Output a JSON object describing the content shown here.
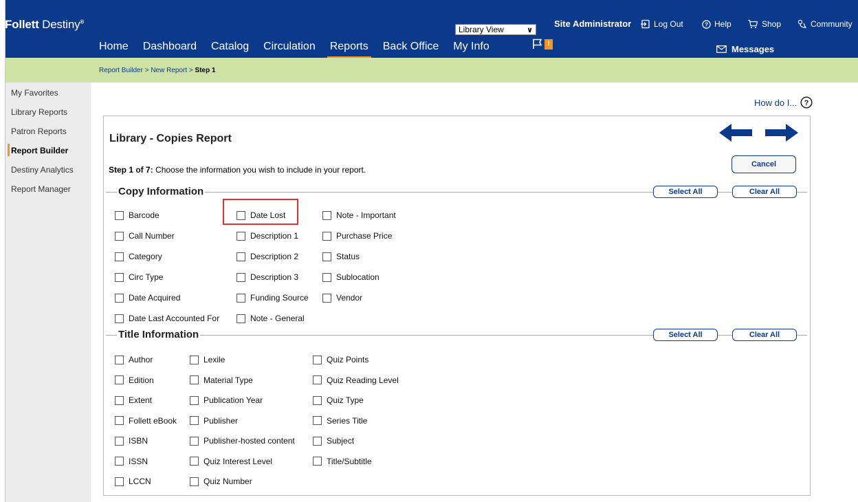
{
  "header": {
    "logo_bold": "Follett",
    "logo_light": " Destiny",
    "logo_reg": "®",
    "view_select": "Library View",
    "user": "Site Administrator",
    "links": {
      "logout": "Log Out",
      "help": "Help",
      "shop": "Shop",
      "community": "Community"
    },
    "nav": [
      "Home",
      "Dashboard",
      "Catalog",
      "Circulation",
      "Reports",
      "Back Office",
      "My Info"
    ],
    "nav_active": "Reports",
    "flag_badge": "!",
    "messages": "Messages"
  },
  "breadcrumb": {
    "items": [
      "Report Builder",
      "New Report"
    ],
    "separator": " > ",
    "current": "Step 1"
  },
  "sidebar": {
    "items": [
      "My Favorites",
      "Library Reports",
      "Patron Reports",
      "Report Builder",
      "Destiny Analytics",
      "Report Manager"
    ],
    "active": "Report Builder"
  },
  "main": {
    "how_do": "How do I...",
    "how_do_icon": "?",
    "title": "Library - Copies Report",
    "step_bold": "Step 1 of 7:",
    "step_text": " Choose the information you wish to include in your report.",
    "cancel": "Cancel",
    "select_all": "Select All",
    "clear_all": "Clear All",
    "copy_section": {
      "title": "Copy Information",
      "columns": [
        [
          "Barcode",
          "Call Number",
          "Category",
          "Circ Type",
          "Date Acquired",
          "Date Last Accounted For"
        ],
        [
          "Date Lost",
          "Description 1",
          "Description 2",
          "Description 3",
          "Funding Source",
          "Note - General"
        ],
        [
          "Note - Important",
          "Purchase Price",
          "Status",
          "Sublocation",
          "Vendor"
        ]
      ]
    },
    "title_section": {
      "title": "Title Information",
      "columns": [
        [
          "Author",
          "Edition",
          "Extent",
          "Follett eBook",
          "ISBN",
          "ISSN",
          "LCCN"
        ],
        [
          "Lexile",
          "Material Type",
          "Publication Year",
          "Publisher",
          "Publisher-hosted content",
          "Quiz Interest Level",
          "Quiz Number"
        ],
        [
          "Quiz Points",
          "Quiz Reading Level",
          "Quiz Type",
          "Series Title",
          "Subject",
          "Title/Subtitle"
        ]
      ]
    }
  },
  "colors": {
    "header_bg": "#0b3a8c",
    "accent": "#f7931e",
    "crumb_bg": "#cfe2a5",
    "sidebar_bg": "#ececec",
    "highlight": "#e0322f"
  }
}
